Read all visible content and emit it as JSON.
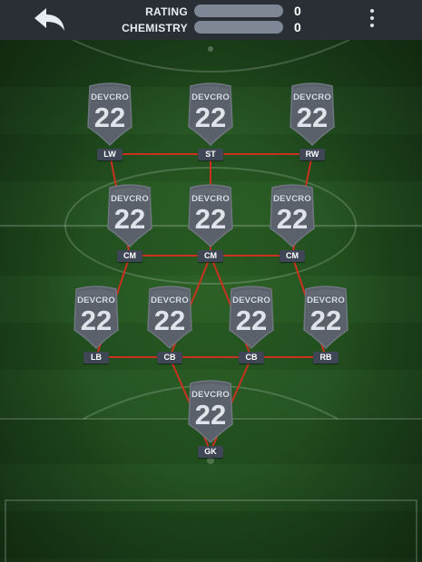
{
  "header": {
    "rating_label": "RATING",
    "rating_value": "0",
    "rating_progress": 0,
    "chemistry_label": "CHEMISTRY",
    "chemistry_value": "0",
    "chemistry_progress": 0,
    "back_icon": "back-arrow-icon",
    "menu_icon": "more-vertical-icon"
  },
  "colors": {
    "topbar": "#2a2f36",
    "link_line": "#c8321e",
    "card": "#5b616b",
    "position_badge": "#3f4655"
  },
  "players": [
    {
      "id": "lw",
      "club": "DEVCRO",
      "number": "22",
      "position": "LW"
    },
    {
      "id": "st",
      "club": "DEVCRO",
      "number": "22",
      "position": "ST"
    },
    {
      "id": "rw",
      "club": "DEVCRO",
      "number": "22",
      "position": "RW"
    },
    {
      "id": "cm-left",
      "club": "DEVCRO",
      "number": "22",
      "position": "CM"
    },
    {
      "id": "cm-center",
      "club": "DEVCRO",
      "number": "22",
      "position": "CM"
    },
    {
      "id": "cm-right",
      "club": "DEVCRO",
      "number": "22",
      "position": "CM"
    },
    {
      "id": "lb",
      "club": "DEVCRO",
      "number": "22",
      "position": "LB"
    },
    {
      "id": "cb-left",
      "club": "DEVCRO",
      "number": "22",
      "position": "CB"
    },
    {
      "id": "cb-right",
      "club": "DEVCRO",
      "number": "22",
      "position": "CB"
    },
    {
      "id": "rb",
      "club": "DEVCRO",
      "number": "22",
      "position": "RB"
    },
    {
      "id": "gk",
      "club": "DEVCRO",
      "number": "22",
      "position": "GK"
    }
  ]
}
